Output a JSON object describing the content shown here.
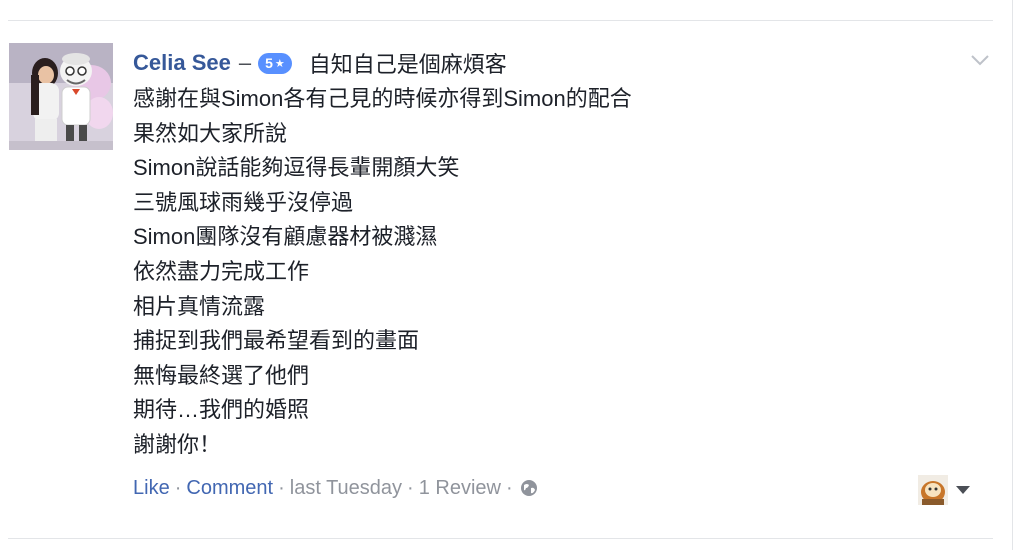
{
  "review": {
    "author": "Celia See",
    "dash": "–",
    "rating": "5",
    "rating_icon": "star-icon",
    "headline": "自知自己是個麻煩客",
    "lines": [
      "感謝在與Simon各有己見的時候亦得到Simon的配合",
      "果然如大家所說",
      "Simon說話能夠逗得長輩開顏大笑",
      "三號風球雨幾乎沒停過",
      "Simon團隊沒有顧慮器材被濺濕",
      "依然盡力完成工作",
      "相片真情流露",
      "捕捉到我們最希望看到的畫面",
      "無悔最終選了他們",
      "期待…我們的婚照",
      "謝謝你！"
    ]
  },
  "footer": {
    "like": "Like",
    "comment": "Comment",
    "timestamp": "last Tuesday",
    "review_count": "1 Review",
    "separator": "·",
    "privacy_icon": "globe-icon"
  },
  "colors": {
    "author": "#365899",
    "link": "#4267b2",
    "meta": "#90949c",
    "badge": "#5890ff",
    "text": "#1d2129"
  }
}
